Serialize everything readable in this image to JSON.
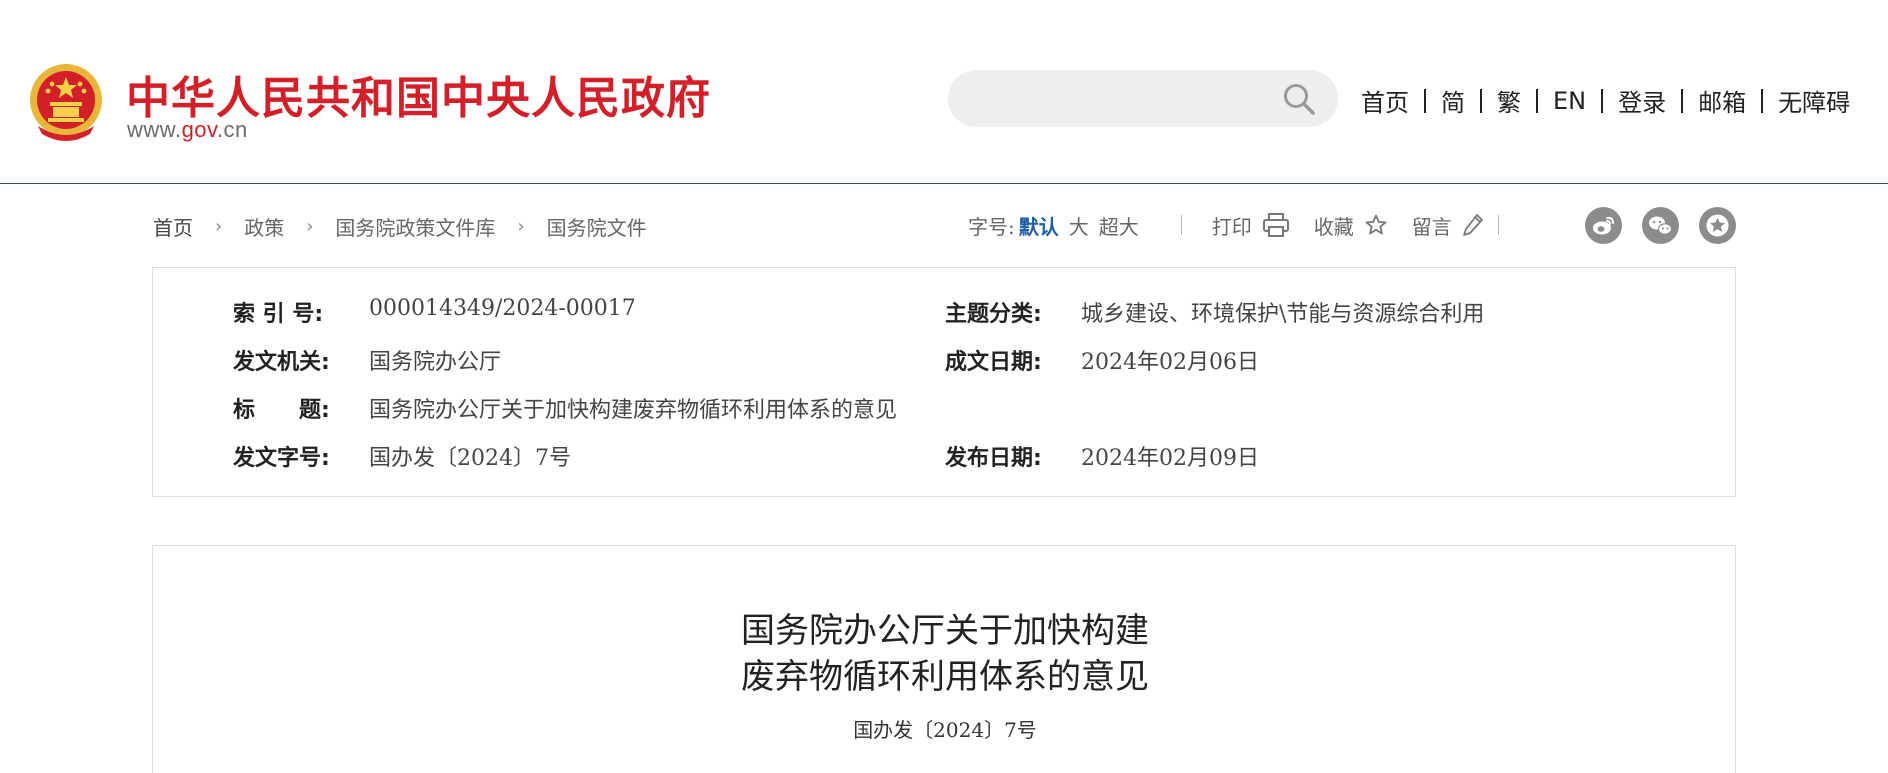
{
  "header": {
    "site_name": "中华人民共和国中央人民政府",
    "site_url_prefix": "www.",
    "site_url_gov": "gov",
    "site_url_suffix": ".cn",
    "search": {
      "placeholder": "",
      "value": "",
      "icon": "search-icon"
    },
    "nav": [
      "首页",
      "简",
      "繁",
      "EN",
      "登录",
      "邮箱",
      "无障碍"
    ]
  },
  "breadcrumb": [
    "首页",
    "政策",
    "国务院政策文件库",
    "国务院文件"
  ],
  "tools": {
    "font_size_label": "字号:",
    "font_sizes": [
      "默认",
      "大",
      "超大"
    ],
    "print_label": "打印",
    "favorite_label": "收藏",
    "comment_label": "留言",
    "share": [
      "weibo-icon",
      "wechat-icon",
      "star-share-icon"
    ]
  },
  "info": {
    "index_no_label": "索 引 号:",
    "index_no": "000014349/2024-00017",
    "topic_label": "主题分类:",
    "topic": "城乡建设、环境保护\\节能与资源综合利用",
    "issuer_label": "发文机关:",
    "issuer": "国务院办公厅",
    "written_date_label": "成文日期:",
    "written_date": "2024年02月06日",
    "title_label": "标　　题:",
    "title": "国务院办公厅关于加快构建废弃物循环利用体系的意见",
    "doc_no_label": "发文字号:",
    "doc_no": "国办发〔2024〕7号",
    "publish_date_label": "发布日期:",
    "publish_date": "2024年02月09日"
  },
  "document": {
    "title_line1": "国务院办公厅关于加快构建",
    "title_line2": "废弃物循环利用体系的意见",
    "doc_no": "国办发〔2024〕7号"
  },
  "colors": {
    "brand_red": "#d21f28",
    "link_blue": "#1f5fa8",
    "header_border": "#1f4e79",
    "share_grey": "#8c8c8c"
  }
}
